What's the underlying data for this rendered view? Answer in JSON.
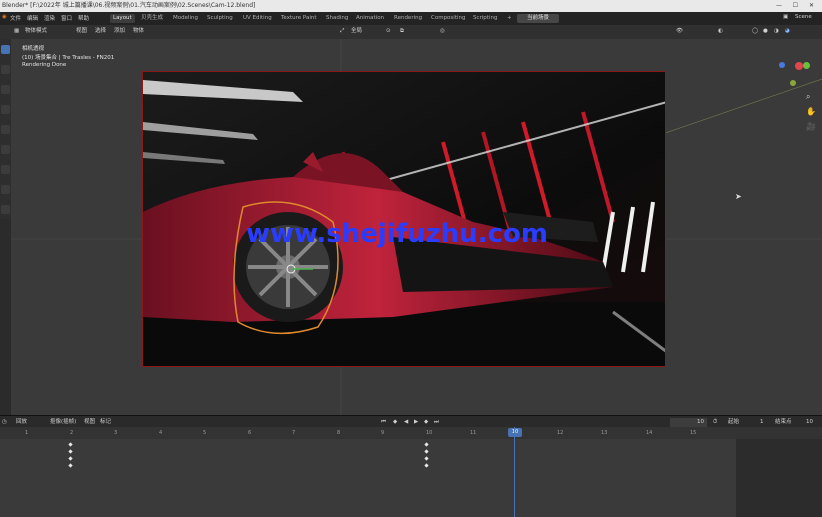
{
  "window": {
    "title": "Blender* [F:\\2022年 城上篇播课\\06.视频案例\\01.汽车动画案例\\02.Scenes\\Cam-12.blend]"
  },
  "menu": {
    "items": [
      "文件",
      "编辑",
      "渲染",
      "窗口",
      "帮助"
    ],
    "workspaces": [
      "Layout",
      "贝壳生成",
      "Modeling",
      "Sculpting",
      "UV Editing",
      "Texture Paint",
      "Shading",
      "Animation",
      "Rendering",
      "Compositing",
      "Scripting"
    ],
    "active_workspace": "Layout",
    "plus": "+",
    "mode_button": "当前场景",
    "scene_label": "Scene"
  },
  "header3d": {
    "mode": "物体模式",
    "view": "视图",
    "select": "选择",
    "add": "添加",
    "object": "物体",
    "orientation": "全局"
  },
  "viewport": {
    "camera_label": "相机透视",
    "collection_label": "(10) 场景集合 | Tre Trasles - FN201",
    "status": "Rendering Done"
  },
  "watermark": {
    "text": "www.shejifuzhu.com"
  },
  "timeline": {
    "menu": [
      "回放",
      "抠像(插帧)",
      "视图",
      "标记"
    ],
    "current_frame": "10",
    "start_label": "起始",
    "start_value": "1",
    "end_label": "结束点",
    "end_value": "10",
    "ticks": [
      "1",
      "2",
      "3",
      "4",
      "5",
      "6",
      "7",
      "8",
      "9",
      "10",
      "11",
      "12",
      "13",
      "14",
      "15"
    ]
  },
  "colors": {
    "accent": "#4772b3",
    "selection_outline": "#e08a2c",
    "render_border": "#8a1a1a",
    "watermark": "#2a3cff",
    "playhead": "#4772b3"
  }
}
